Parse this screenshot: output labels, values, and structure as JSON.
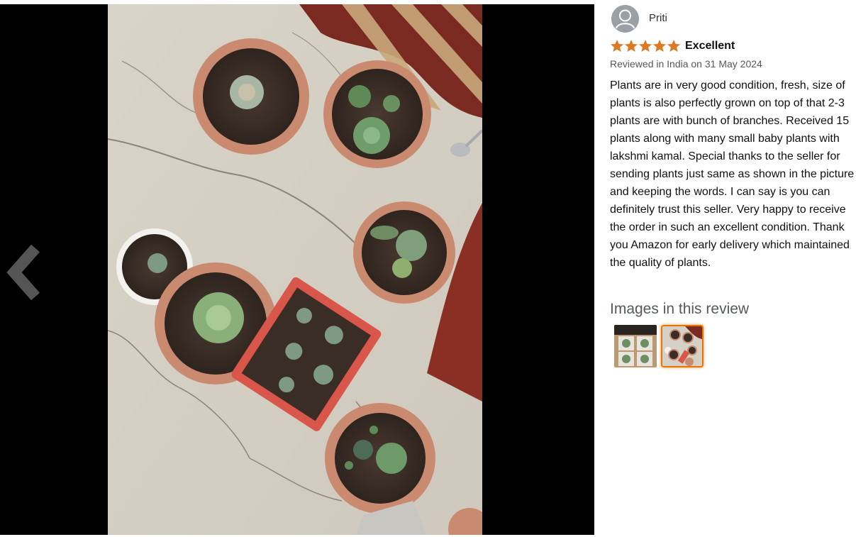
{
  "reviewer": {
    "name": "Priti",
    "avatar_icon": "default-user-avatar"
  },
  "review": {
    "rating_out_of_5": 5,
    "title": "Excellent",
    "meta": "Reviewed in India on 31 May 2024",
    "body": "Plants are in very good condition, fresh, size of plants is also perfectly grown on top of that 2-3 plants are with bunch of branches. Received 15 plants along with many small baby plants with lakshmi kamal. Special thanks to the seller for sending plants just same as shown in the picture and keeping the words. I can say is you can definitely trust this seller. Very happy to receive the order in such an excellent condition. Thank you Amazon for early delivery which maintained the quality of plants."
  },
  "images_section": {
    "heading": "Images in this review",
    "selected_index": 1,
    "count": 2
  },
  "viewer": {
    "nav_icon": "chevron-left-icon"
  },
  "colors": {
    "star": "#de7921",
    "viewer_background": "#000000",
    "selected_border": "#e77600",
    "meta_text": "#565959"
  }
}
